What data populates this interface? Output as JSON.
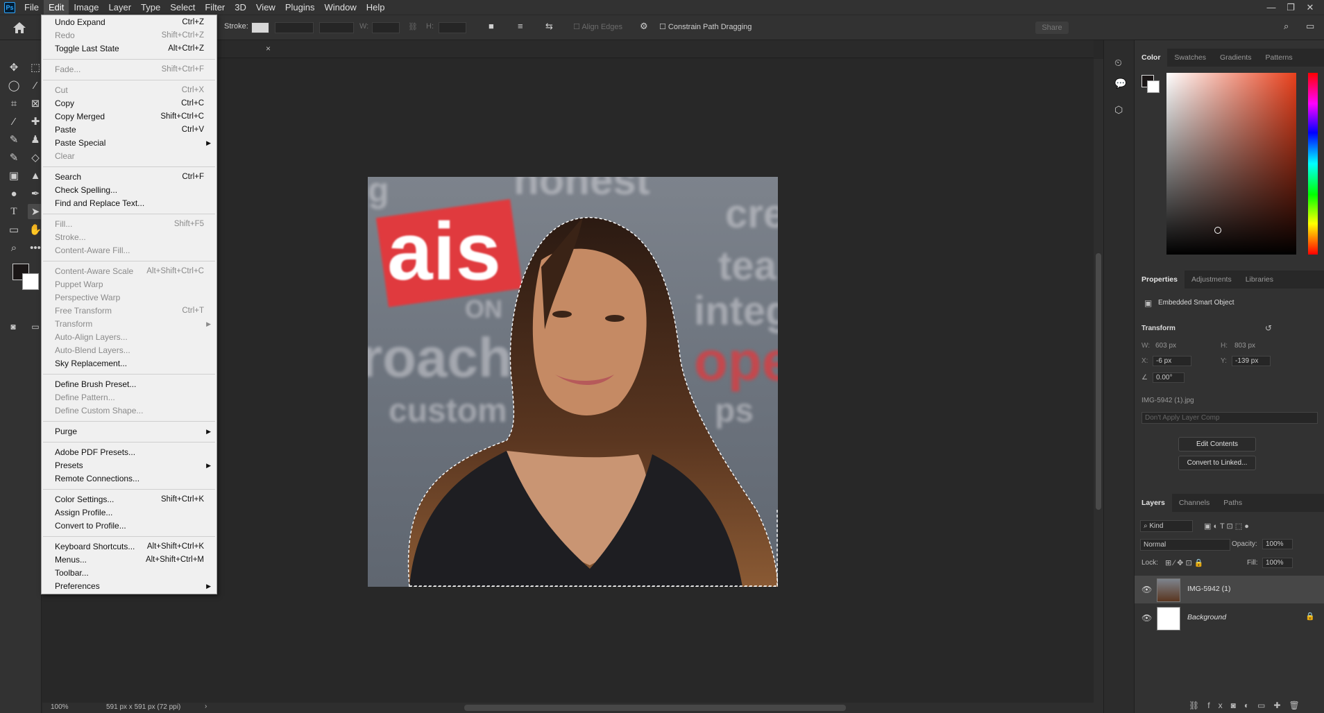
{
  "app": {
    "logo": "Ps",
    "menus": [
      "File",
      "Edit",
      "Image",
      "Layer",
      "Type",
      "Select",
      "Filter",
      "3D",
      "View",
      "Plugins",
      "Window",
      "Help"
    ],
    "active_menu": "Edit",
    "window_controls": [
      "minimize-icon",
      "restore-icon",
      "close-icon"
    ]
  },
  "options_bar": {
    "stroke_label": "Stroke:",
    "w_label": "W:",
    "h_label": "H:",
    "align_edges": "Align Edges",
    "constrain": "Constrain Path Dragging",
    "share": "Share"
  },
  "document": {
    "close_glyph": "×",
    "zoom": "100%",
    "doc_info": "591 px x 591 px (72 ppi)",
    "photo_words": [
      "honest",
      "ais",
      "cre",
      "tea",
      "integr",
      "roach",
      "ope",
      "custom",
      "ps",
      "ON",
      "g"
    ]
  },
  "edit_menu": [
    {
      "label": "Undo Expand",
      "shortcut": "Ctrl+Z",
      "enabled": true
    },
    {
      "label": "Redo",
      "shortcut": "Shift+Ctrl+Z",
      "enabled": false
    },
    {
      "label": "Toggle Last State",
      "shortcut": "Alt+Ctrl+Z",
      "enabled": true
    },
    {
      "separator": true
    },
    {
      "label": "Fade...",
      "shortcut": "Shift+Ctrl+F",
      "enabled": false
    },
    {
      "separator": true
    },
    {
      "label": "Cut",
      "shortcut": "Ctrl+X",
      "enabled": false
    },
    {
      "label": "Copy",
      "shortcut": "Ctrl+C",
      "enabled": true
    },
    {
      "label": "Copy Merged",
      "shortcut": "Shift+Ctrl+C",
      "enabled": true
    },
    {
      "label": "Paste",
      "shortcut": "Ctrl+V",
      "enabled": true
    },
    {
      "label": "Paste Special",
      "submenu": true,
      "enabled": true
    },
    {
      "label": "Clear",
      "enabled": false
    },
    {
      "separator": true
    },
    {
      "label": "Search",
      "shortcut": "Ctrl+F",
      "enabled": true
    },
    {
      "label": "Check Spelling...",
      "enabled": true
    },
    {
      "label": "Find and Replace Text...",
      "enabled": true
    },
    {
      "separator": true
    },
    {
      "label": "Fill...",
      "shortcut": "Shift+F5",
      "enabled": false
    },
    {
      "label": "Stroke...",
      "enabled": false
    },
    {
      "label": "Content-Aware Fill...",
      "enabled": false
    },
    {
      "separator": true
    },
    {
      "label": "Content-Aware Scale",
      "shortcut": "Alt+Shift+Ctrl+C",
      "enabled": false
    },
    {
      "label": "Puppet Warp",
      "enabled": false
    },
    {
      "label": "Perspective Warp",
      "enabled": false
    },
    {
      "label": "Free Transform",
      "shortcut": "Ctrl+T",
      "enabled": false
    },
    {
      "label": "Transform",
      "submenu": true,
      "enabled": false
    },
    {
      "label": "Auto-Align Layers...",
      "enabled": false
    },
    {
      "label": "Auto-Blend Layers...",
      "enabled": false
    },
    {
      "label": "Sky Replacement...",
      "enabled": true
    },
    {
      "separator": true
    },
    {
      "label": "Define Brush Preset...",
      "enabled": true
    },
    {
      "label": "Define Pattern...",
      "enabled": false
    },
    {
      "label": "Define Custom Shape...",
      "enabled": false
    },
    {
      "separator": true
    },
    {
      "label": "Purge",
      "submenu": true,
      "enabled": true
    },
    {
      "separator": true
    },
    {
      "label": "Adobe PDF Presets...",
      "enabled": true
    },
    {
      "label": "Presets",
      "submenu": true,
      "enabled": true
    },
    {
      "label": "Remote Connections...",
      "enabled": true
    },
    {
      "separator": true
    },
    {
      "label": "Color Settings...",
      "shortcut": "Shift+Ctrl+K",
      "enabled": true
    },
    {
      "label": "Assign Profile...",
      "enabled": true
    },
    {
      "label": "Convert to Profile...",
      "enabled": true
    },
    {
      "separator": true
    },
    {
      "label": "Keyboard Shortcuts...",
      "shortcut": "Alt+Shift+Ctrl+K",
      "enabled": true
    },
    {
      "label": "Menus...",
      "shortcut": "Alt+Shift+Ctrl+M",
      "enabled": true
    },
    {
      "label": "Toolbar...",
      "enabled": true
    },
    {
      "label": "Preferences",
      "submenu": true,
      "enabled": true
    }
  ],
  "color_panel": {
    "tabs": [
      "Color",
      "Swatches",
      "Gradients",
      "Patterns"
    ],
    "foreground": "#1a1616",
    "background": "#ffffff"
  },
  "properties_panel": {
    "tabs": [
      "Properties",
      "Adjustments",
      "Libraries"
    ],
    "object_type": "Embedded Smart Object",
    "transform_label": "Transform",
    "w_label": "W:",
    "w": "603 px",
    "h_label": "H:",
    "h": "803 px",
    "x_label": "X:",
    "x": "-6 px",
    "y_label": "Y:",
    "y": "-139 px",
    "angle": "0.00°",
    "file": "IMG-5942 (1).jpg",
    "layer_comp": "Don't Apply Layer Comp",
    "edit_contents": "Edit Contents",
    "convert_linked": "Convert to Linked..."
  },
  "layers_panel": {
    "tabs": [
      "Layers",
      "Channels",
      "Paths"
    ],
    "filter": "Kind",
    "blend_mode": "Normal",
    "opacity_label": "Opacity:",
    "opacity": "100%",
    "lock_label": "Lock:",
    "fill_label": "Fill:",
    "fill": "100%",
    "layers": [
      {
        "name": "IMG-5942 (1)",
        "selected": true
      },
      {
        "name": "Background",
        "selected": false,
        "locked": true
      }
    ]
  }
}
